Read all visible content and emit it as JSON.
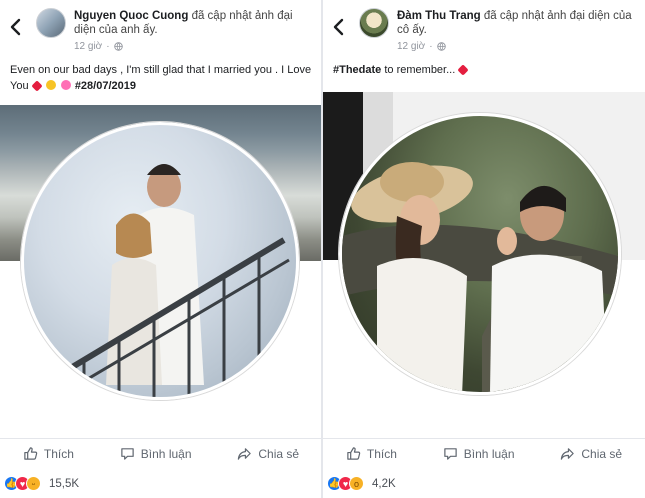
{
  "posts": [
    {
      "author": "Nguyen Quoc Cuong",
      "action": "đã cập nhật ảnh đại diện của anh ấy.",
      "time": "12 giờ",
      "caption_text": "Even on our bad days , I'm still glad that I married you . I Love You",
      "caption_tag": "#28/07/2019",
      "emojis": [
        "red-heart",
        "kiss-face",
        "sparkling-heart"
      ],
      "actions": {
        "like": "Thích",
        "comment": "Bình luận",
        "share": "Chia sẻ"
      },
      "reaction_count": "15,5K",
      "reactions": [
        "like",
        "love",
        "haha"
      ]
    },
    {
      "author": "Đàm Thu Trang",
      "action": "đã cập nhật ảnh đại diện của cô ấy.",
      "time": "12 giờ",
      "caption_tag": "#Thedate",
      "caption_text": "to remember...",
      "emojis": [
        "red-heart"
      ],
      "actions": {
        "like": "Thích",
        "comment": "Bình luận",
        "share": "Chia sẻ"
      },
      "reaction_count": "4,2K",
      "reactions": [
        "like",
        "love",
        "wow"
      ]
    }
  ],
  "colors": {
    "like": "#1877f2",
    "love": "#f0284a",
    "haha": "#f7b125",
    "text": "#1c1e21",
    "muted": "#90949c"
  }
}
